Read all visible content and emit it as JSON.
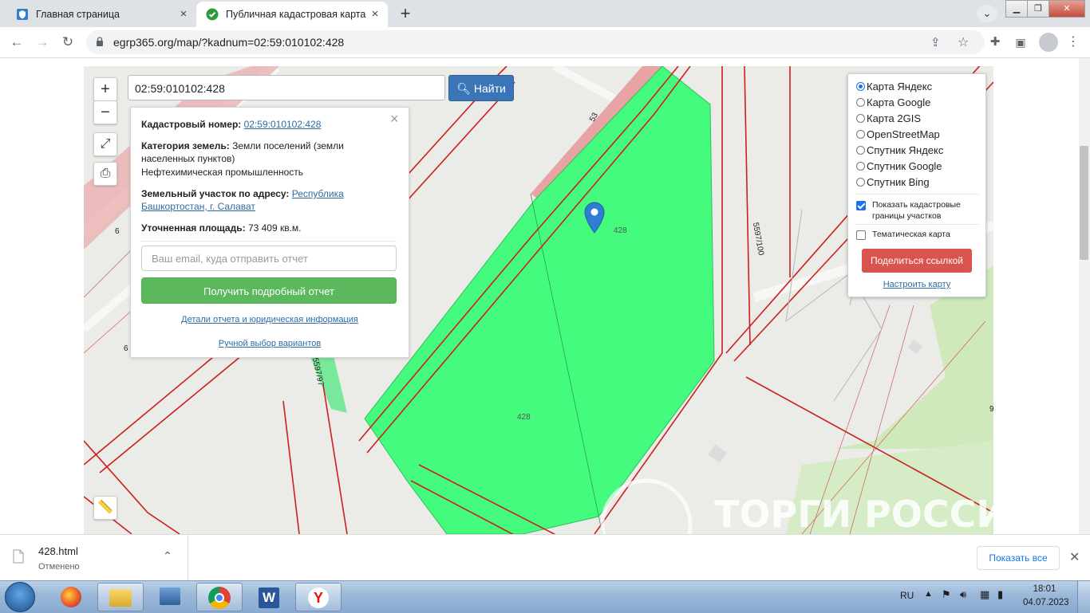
{
  "browser": {
    "tabs": [
      {
        "title": "Главная страница",
        "active": false
      },
      {
        "title": "Публичная кадастровая карта -",
        "active": true
      }
    ],
    "url": "egrp365.org/map/?kadnum=02:59:010102:428"
  },
  "map": {
    "search": {
      "value": "02:59:010102:428",
      "button_label": "Найти"
    },
    "zoom_in": "+",
    "zoom_out": "−",
    "info_popup": {
      "cadastral_label": "Кадастровый номер:",
      "cadastral_value": "02:59:010102:428",
      "category_label": "Категория земель:",
      "category_value": "Земли поселений (земли населенных пунктов)",
      "use_value": "Нефтехимическая промышленность",
      "address_label": "Земельный участок по адресу:",
      "address_value": "Республика Башкортостан, г. Салават",
      "area_label": "Уточненная площадь:",
      "area_value": "73 409 кв.м.",
      "email_placeholder": "Ваш email, куда отправить отчет",
      "report_button": "Получить подробный отчет",
      "details_link": "Детали отчета и юридическая информация",
      "manual_link": "Ручной выбор вариантов"
    },
    "layers": {
      "options": [
        {
          "label": "Карта Яндекс",
          "selected": true
        },
        {
          "label": "Карта Google",
          "selected": false
        },
        {
          "label": "Карта 2GIS",
          "selected": false
        },
        {
          "label": "OpenStreetMap",
          "selected": false
        },
        {
          "label": "Спутник Яндекс",
          "selected": false
        },
        {
          "label": "Спутник Google",
          "selected": false
        },
        {
          "label": "Спутник Bing",
          "selected": false
        }
      ],
      "show_borders": {
        "label": "Показать кадастровые границы участков",
        "checked": true
      },
      "thematic": {
        "label": "Тематическая карта",
        "checked": false
      },
      "share_button": "Поделиться ссылкой",
      "config_link": "Настроить карту"
    },
    "labels": {
      "parcel_main": "428",
      "parcel_pin": "428",
      "road_num": "53",
      "boundary_a": "5597/100",
      "boundary_b": "5597/97",
      "edge_a": "6",
      "edge_b": "6",
      "edge_c": "9",
      "watermark": "ТОРГИ РОССИИ"
    },
    "colors": {
      "parcel": "#45fb7d",
      "boundary": "#cc1f1f",
      "road_pink": "#e8a4a4"
    }
  },
  "download_shelf": {
    "file_name": "428.html",
    "status": "Отменено",
    "show_all": "Показать все"
  },
  "taskbar": {
    "lang": "RU",
    "time": "18:01",
    "date": "04.07.2023"
  }
}
